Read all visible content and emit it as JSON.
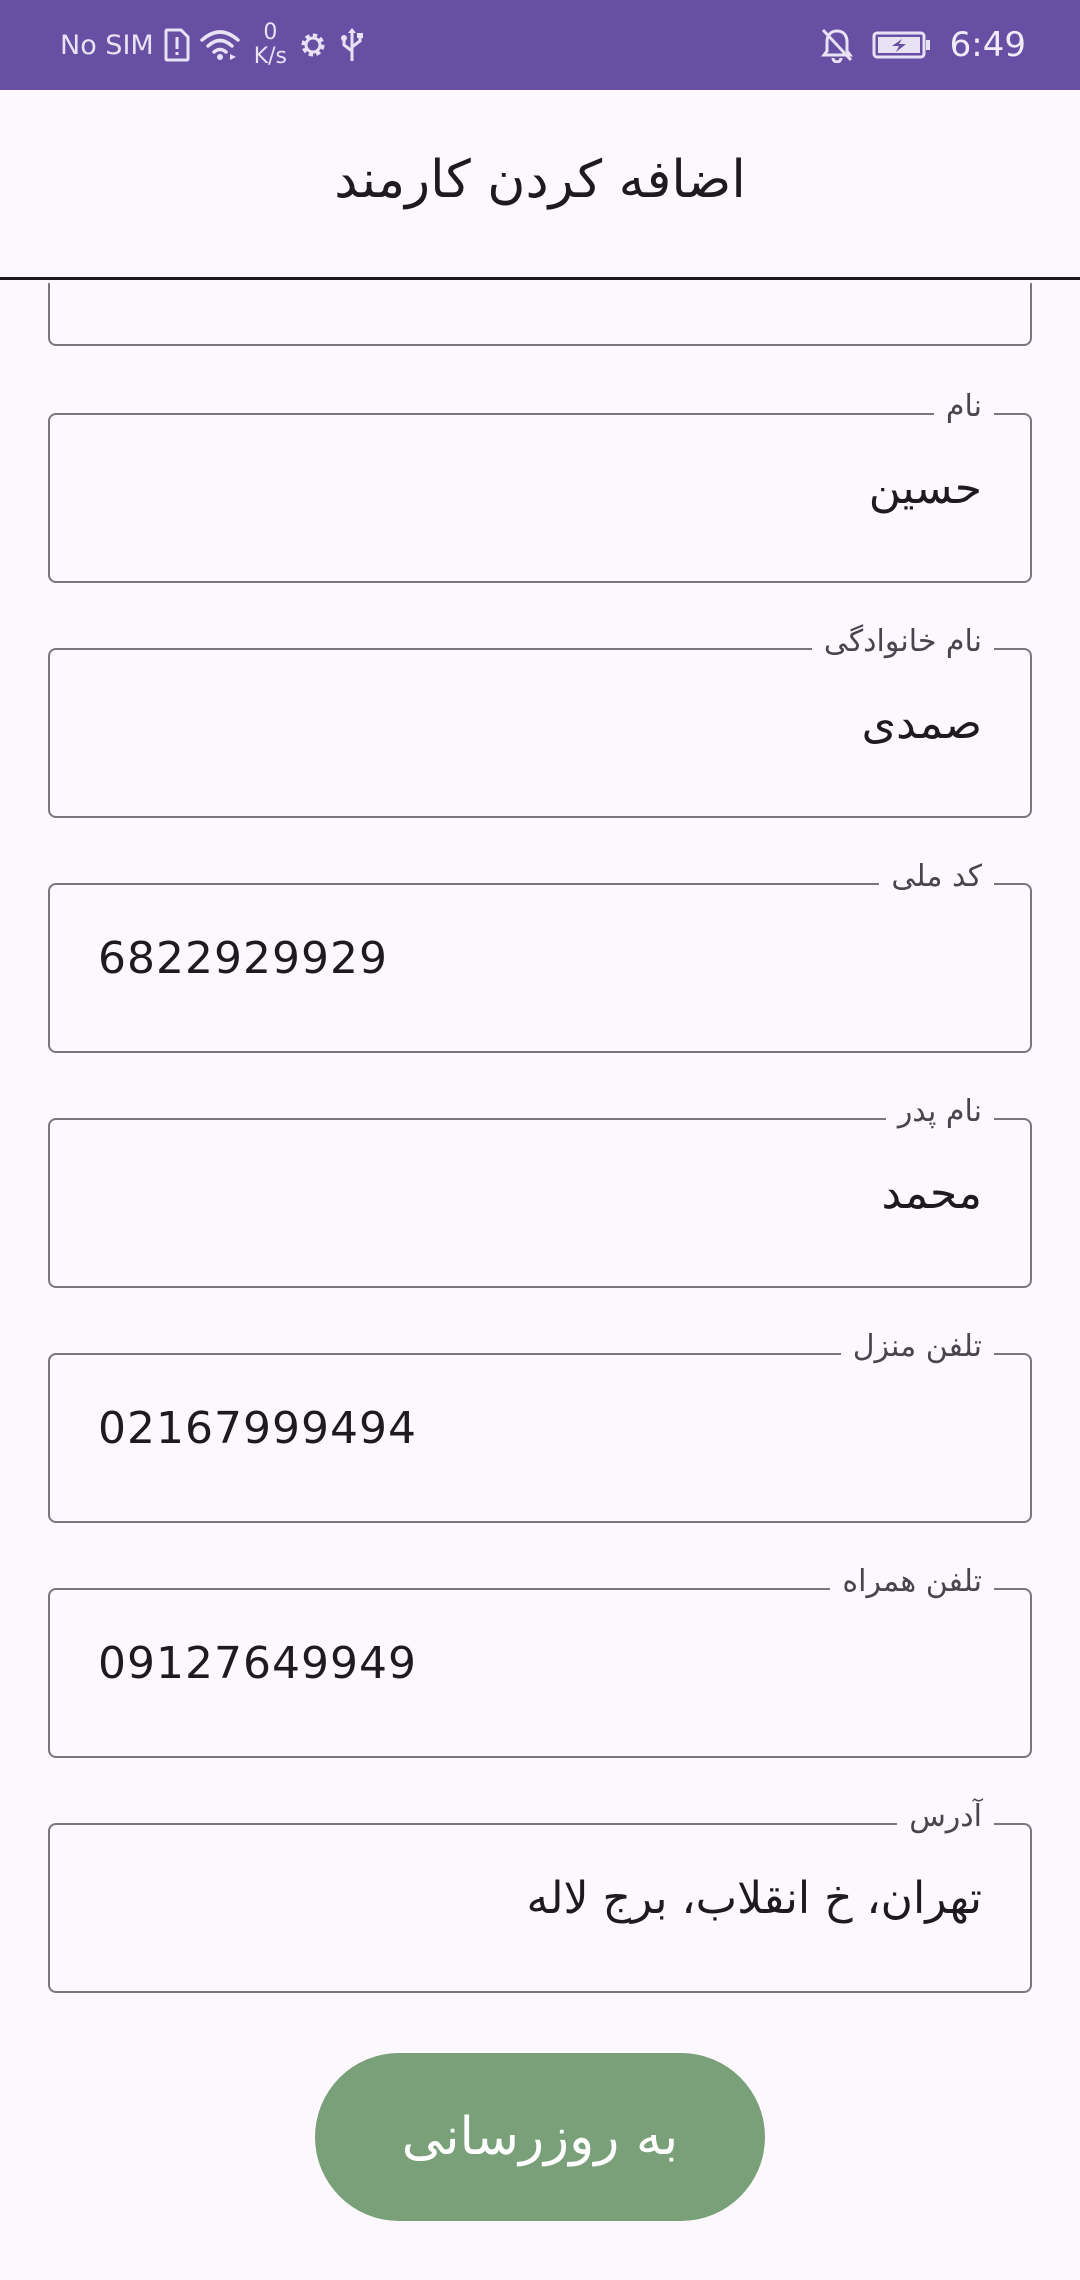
{
  "status_bar": {
    "carrier": "No SIM",
    "net_speed_value": "0",
    "net_speed_unit": "K/s",
    "time": "6:49",
    "icons": [
      "sim-card-alert-icon",
      "wifi-icon",
      "settings-icon",
      "usb-icon",
      "notifications-off-icon",
      "battery-charging-icon"
    ]
  },
  "app_bar": {
    "title": "اضافه کردن کارمند"
  },
  "form": {
    "first_name": {
      "label": "نام",
      "value": "حسین"
    },
    "last_name": {
      "label": "نام خانوادگی",
      "value": "صمدی"
    },
    "national_code": {
      "label": "کد ملی",
      "value": "6822929929"
    },
    "father_name": {
      "label": "نام پدر",
      "value": "محمد"
    },
    "home_phone": {
      "label": "تلفن منزل",
      "value": "02167999494"
    },
    "mobile_phone": {
      "label": "تلفن همراه",
      "value": "09127649949"
    },
    "address": {
      "label": "آدرس",
      "value": "تهران، خ انقلاب، برج لاله"
    }
  },
  "actions": {
    "update_label": "به روزرسانی"
  },
  "colors": {
    "status_bar_bg": "#6750a4",
    "page_bg": "#fdf8fd",
    "field_border": "#7a757f",
    "button_bg": "#79a078"
  }
}
